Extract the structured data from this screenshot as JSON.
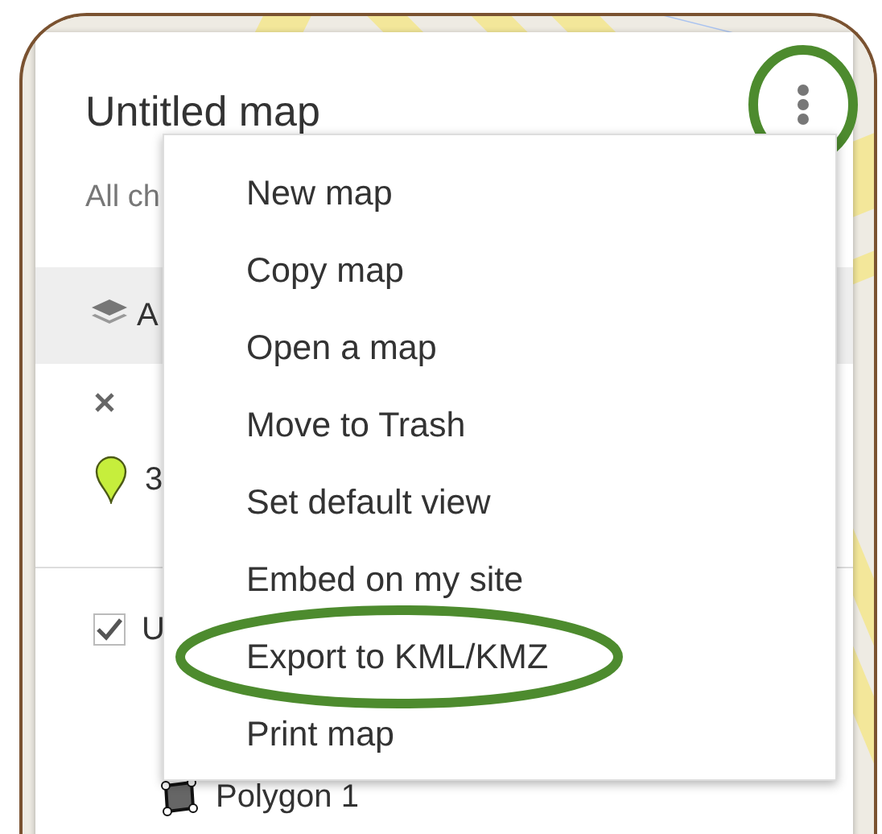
{
  "panel": {
    "title": "Untitled map",
    "subtitle": "All ch",
    "menu_button": {
      "highlighted": true
    },
    "base_layer": {
      "label": "A"
    },
    "feature": {
      "label": "3"
    },
    "layer": {
      "label": "U",
      "checked": true,
      "items": [
        {
          "label": "Polygon 1"
        }
      ]
    }
  },
  "menu": {
    "items": [
      {
        "label": "New map",
        "highlighted": false
      },
      {
        "label": "Copy map",
        "highlighted": false
      },
      {
        "label": "Open a map",
        "highlighted": false
      },
      {
        "label": "Move to Trash",
        "highlighted": false
      },
      {
        "label": "Set default view",
        "highlighted": false
      },
      {
        "label": "Embed on my site",
        "highlighted": false
      },
      {
        "label": "Export to KML/KMZ",
        "highlighted": true
      },
      {
        "label": "Print map",
        "highlighted": false
      }
    ]
  }
}
